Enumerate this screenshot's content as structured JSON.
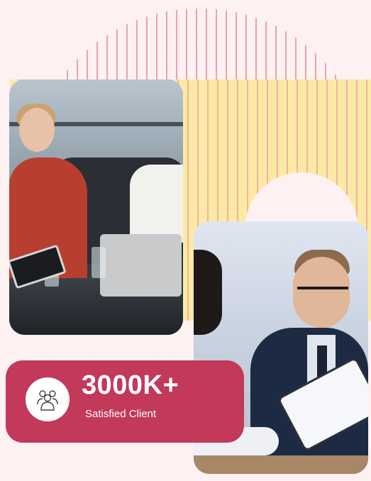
{
  "stat": {
    "value": "3000K+",
    "label": "Satisfied Client",
    "icon": "team-icon"
  },
  "colors": {
    "badge": "#c2395a",
    "background": "#fdf1f2",
    "accent_yellow": "#fde9a6",
    "stripe": "#e49aaa"
  }
}
